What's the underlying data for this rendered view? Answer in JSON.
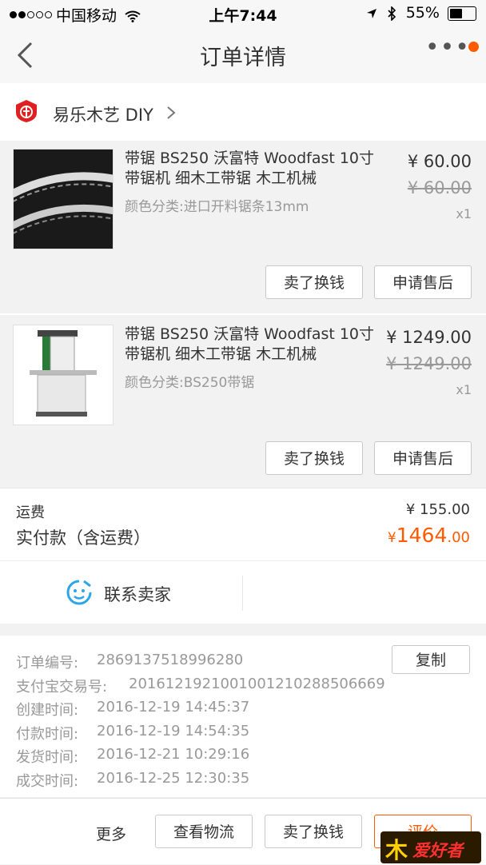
{
  "status_bar": {
    "carrier": "中国移动",
    "time": "上午7:44",
    "battery": "55%"
  },
  "nav": {
    "title": "订单详情"
  },
  "shop": {
    "name": "易乐木艺 DIY"
  },
  "items": [
    {
      "title": "带锯 BS250 沃富特 Woodfast 10寸带锯机 细木工带锯 木工机械",
      "variant": "颜色分类:进口开料锯条13mm",
      "price": "¥ 60.00",
      "original_price": "¥ 60.00",
      "qty": "x1",
      "buttons": [
        "卖了换钱",
        "申请售后"
      ]
    },
    {
      "title": "带锯 BS250 沃富特 Woodfast 10寸带锯机 细木工带锯 木工机械",
      "variant": "颜色分类:BS250带锯",
      "price": "¥ 1249.00",
      "original_price": "¥ 1249.00",
      "qty": "x1",
      "buttons": [
        "卖了换钱",
        "申请售后"
      ]
    }
  ],
  "totals": {
    "shipping_label": "运费",
    "shipping_value": "¥ 155.00",
    "paid_label": "实付款（含运费）",
    "paid_symbol": "¥",
    "paid_int": "1464",
    "paid_dec": ".00"
  },
  "contact": {
    "label": "联系卖家"
  },
  "order_info": {
    "copy_label": "复制",
    "rows": [
      {
        "label": "订单编号:",
        "value": "2869137518996280"
      },
      {
        "label": "支付宝交易号:",
        "value": "2016121921001001210288506669"
      },
      {
        "label": "创建时间:",
        "value": "2016-12-19 14:45:37"
      },
      {
        "label": "付款时间:",
        "value": "2016-12-19 14:54:35"
      },
      {
        "label": "发货时间:",
        "value": "2016-12-21 10:29:16"
      },
      {
        "label": "成交时间:",
        "value": "2016-12-25 12:30:35"
      }
    ]
  },
  "bottom_bar": {
    "more": "更多",
    "logistics": "查看物流",
    "sell": "卖了换钱",
    "review": "评价"
  },
  "watermark": {
    "text": "爱好者"
  },
  "colors": {
    "accent": "#ff5a00",
    "muted": "#999999",
    "background": "#f2f2f2"
  },
  "icons": [
    "back-icon",
    "more-icon",
    "shop-logo-icon",
    "chevron-right-icon",
    "contact-face-icon",
    "wifi-icon",
    "location-icon",
    "bluetooth-icon",
    "battery-icon"
  ]
}
